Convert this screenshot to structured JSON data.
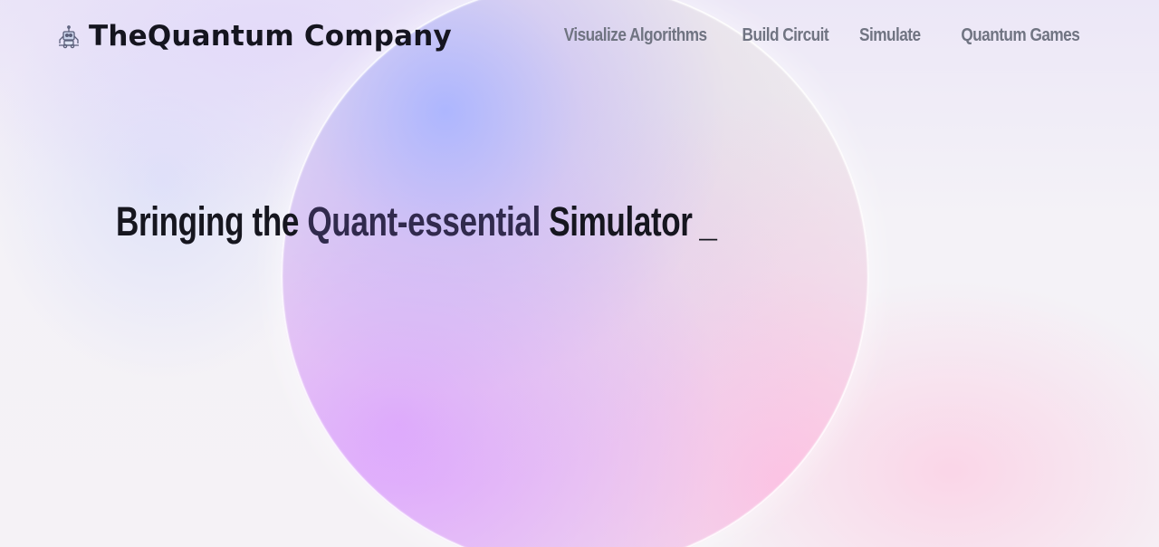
{
  "brand": {
    "logo_icon": "robot-icon",
    "name": "TheQuantum Company"
  },
  "nav": {
    "items": [
      {
        "label": "Visualize Algorithms"
      },
      {
        "label": "Build Circuit"
      },
      {
        "label": "Simulate"
      },
      {
        "label": "Quantum Games"
      }
    ]
  },
  "hero": {
    "prefix": "Bringing the ",
    "accent": "Quant-essential",
    "suffix": " Simulator",
    "cursor": "_"
  },
  "colors": {
    "text_dark": "#16161f",
    "accent": "#312a4d",
    "nav": "#707482",
    "orb_blue": "#aab4ff",
    "orb_violet": "#dca0ff",
    "orb_pink": "#ffbee1"
  }
}
